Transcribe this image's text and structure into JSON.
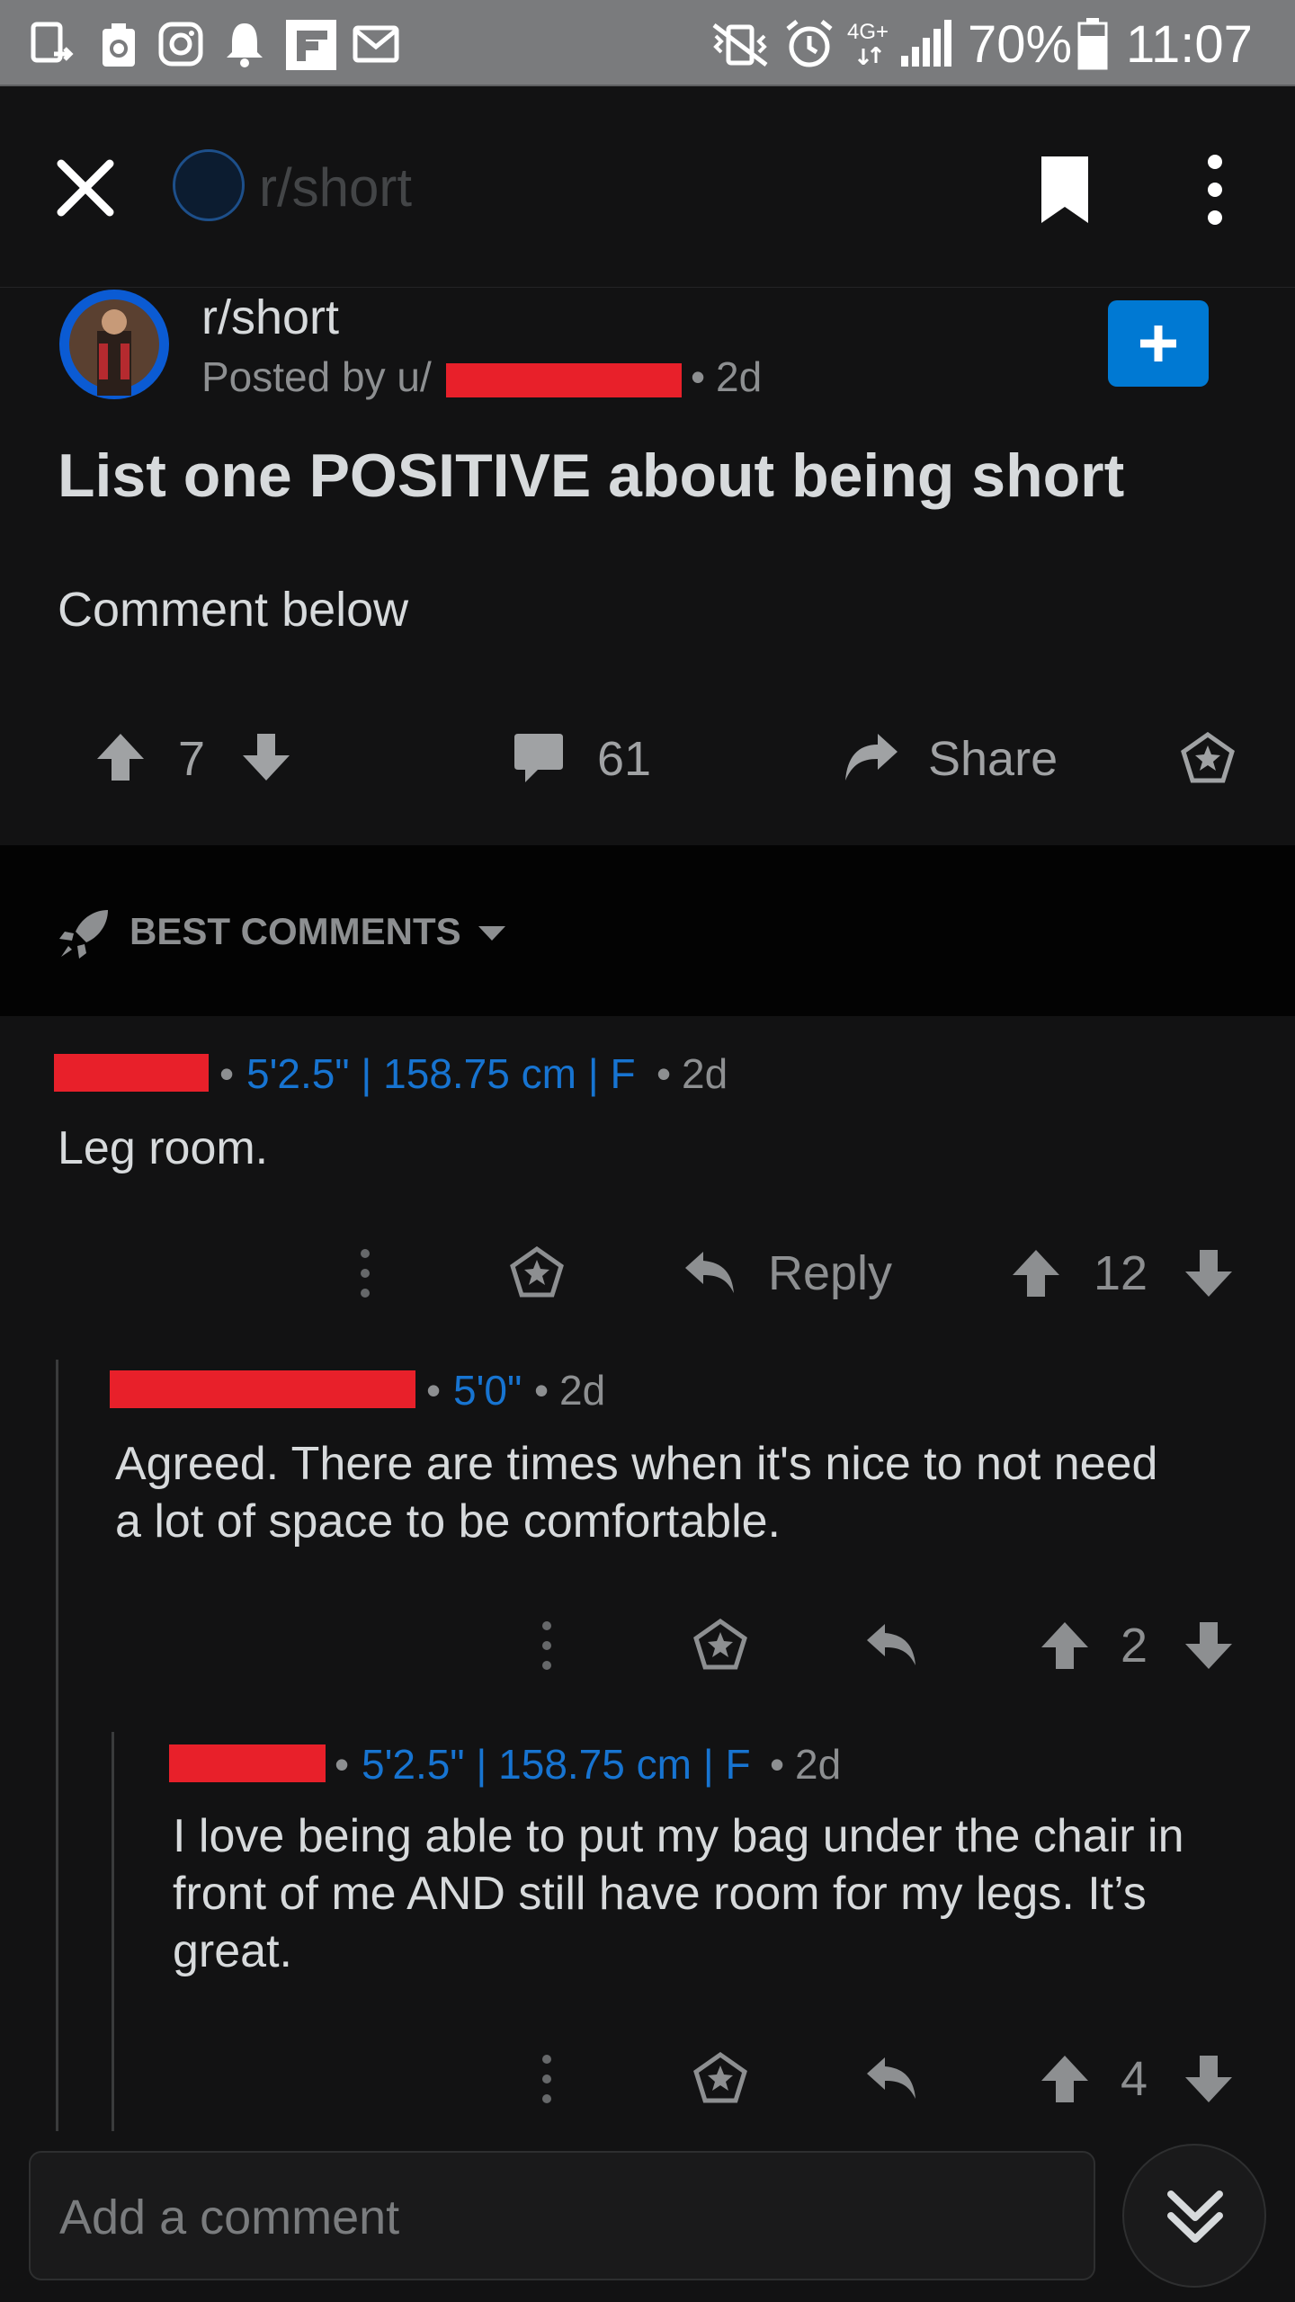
{
  "status_bar": {
    "battery": "70%",
    "time": "11:07",
    "network": "4G+"
  },
  "app_bar": {
    "subreddit": "r/short",
    "icons": [
      "close-icon",
      "bookmark-icon",
      "more-vert-icon"
    ]
  },
  "post": {
    "subreddit": "r/short",
    "posted_by_prefix": "Posted by u/",
    "age": "2d",
    "title": "List one POSITIVE about being short",
    "body": "Comment below",
    "score": "7",
    "comment_count": "61",
    "share_label": "Share"
  },
  "sort": {
    "label": "BEST COMMENTS"
  },
  "comments": [
    {
      "flair": "5'2.5\" | 158.75 cm | F",
      "age": "2d",
      "body": "Leg room.",
      "reply_label": "Reply",
      "score": "12"
    },
    {
      "flair": "5'0\"",
      "age": "2d",
      "body_line1": "Agreed. There are times when it's nice to not need",
      "body_line2": "a lot of space to be comfortable.",
      "score": "2"
    },
    {
      "flair": "5'2.5\" | 158.75 cm | F",
      "age": "2d",
      "body_line1": "I love being able to put my bag under the chair in",
      "body_line2": "front of me AND still have room for my legs. It’s",
      "body_line3": "great.",
      "score": "4"
    }
  ],
  "composer": {
    "placeholder": "Add a comment"
  },
  "colors": {
    "background": "#121213",
    "accent_blue": "#0079d3",
    "flair_blue": "#1774d1",
    "redaction": "#e8202a"
  }
}
